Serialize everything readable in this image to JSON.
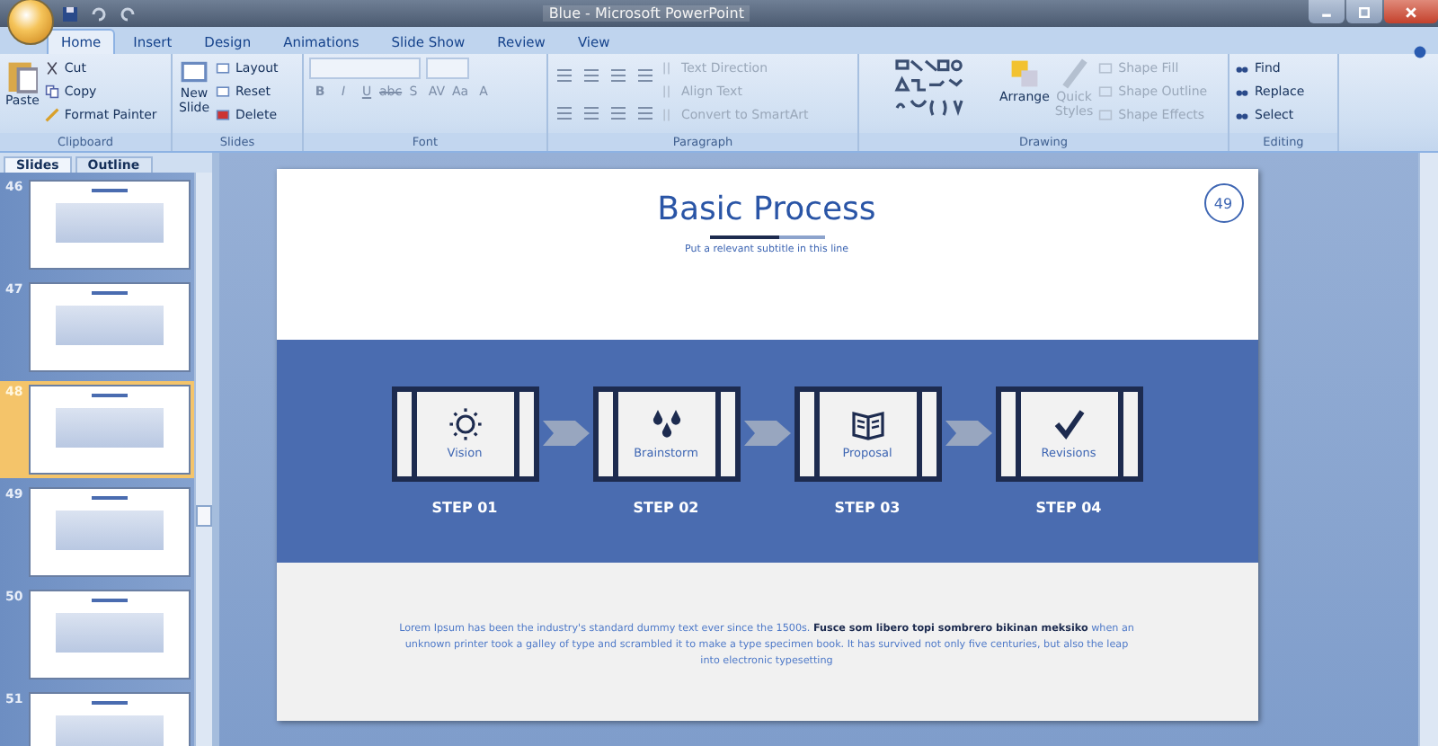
{
  "window": {
    "title": "Blue - Microsoft PowerPoint"
  },
  "tabs": [
    {
      "label": "Home",
      "selected": true
    },
    {
      "label": "Insert",
      "selected": false
    },
    {
      "label": "Design",
      "selected": false
    },
    {
      "label": "Animations",
      "selected": false
    },
    {
      "label": "Slide Show",
      "selected": false
    },
    {
      "label": "Review",
      "selected": false
    },
    {
      "label": "View",
      "selected": false
    }
  ],
  "ribbon": {
    "clipboard": {
      "label": "Clipboard",
      "paste": "Paste",
      "items": [
        "Cut",
        "Copy",
        "Format Painter"
      ]
    },
    "slides": {
      "label": "Slides",
      "new_slide": [
        "New",
        "Slide"
      ],
      "items": [
        "Layout",
        "Reset",
        "Delete"
      ]
    },
    "font": {
      "label": "Font",
      "buttons": [
        "B",
        "I",
        "U",
        "abc",
        "S",
        "AV",
        "Aa",
        "A"
      ]
    },
    "paragraph": {
      "label": "Paragraph",
      "items": [
        {
          "label": "Text Direction",
          "disabled": true
        },
        {
          "label": "Align Text",
          "disabled": true
        },
        {
          "label": "Convert to SmartArt",
          "disabled": true
        }
      ]
    },
    "drawing": {
      "label": "Drawing",
      "arrange": "Arrange",
      "quick_styles": [
        "Quick",
        "Styles"
      ],
      "items": [
        {
          "label": "Shape Fill",
          "disabled": true
        },
        {
          "label": "Shape Outline",
          "disabled": true
        },
        {
          "label": "Shape Effects",
          "disabled": true
        }
      ]
    },
    "editing": {
      "label": "Editing",
      "items": [
        "Find",
        "Replace",
        "Select"
      ]
    }
  },
  "pane": {
    "tabs": [
      {
        "label": "Slides",
        "selected": true
      },
      {
        "label": "Outline",
        "selected": false
      }
    ],
    "thumbnails": [
      {
        "number": "46",
        "selected": false
      },
      {
        "number": "47",
        "selected": false
      },
      {
        "number": "48",
        "selected": true
      },
      {
        "number": "49",
        "selected": false
      },
      {
        "number": "50",
        "selected": false
      },
      {
        "number": "51",
        "selected": false
      }
    ]
  },
  "slide": {
    "title": "Basic Process",
    "subtitle": "Put a relevant subtitle in this line",
    "page_number": "49",
    "steps": [
      {
        "kind": "sun",
        "label": "Vision",
        "step": "STEP 01"
      },
      {
        "kind": "drops",
        "label": "Brainstorm",
        "step": "STEP 02"
      },
      {
        "kind": "book",
        "label": "Proposal",
        "step": "STEP 03"
      },
      {
        "kind": "check",
        "label": "Revisions",
        "step": "STEP 04"
      }
    ],
    "body": "Lorem Ipsum has been the industry's standard dummy text ever since the 1500s. **Fusce som libero topi sombrero bikinan meksiko** when an unknown printer took a galley of type and scrambled it to make a type specimen book. It has survived not only five centuries, but also the leap into electronic typesetting"
  }
}
